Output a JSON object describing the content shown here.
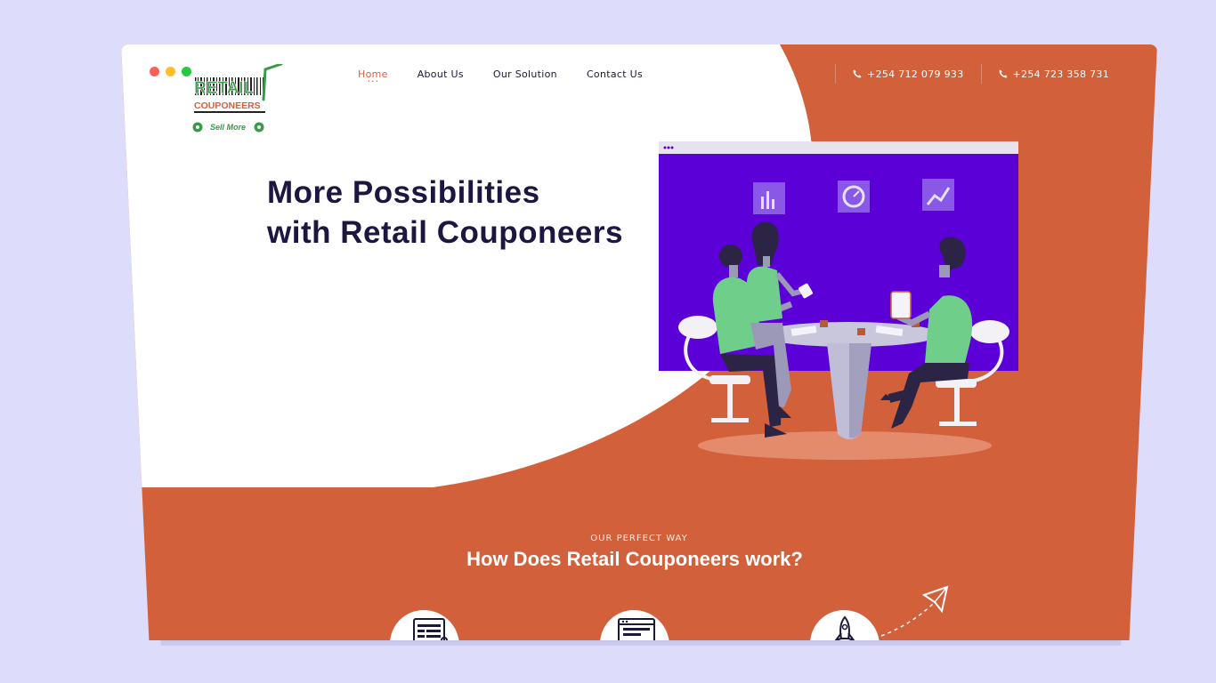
{
  "window": {
    "traffic_lights": [
      "#fe5f57",
      "#febc2e",
      "#28c840"
    ]
  },
  "logo": {
    "icon": "retail-couponeers-logo",
    "line1": "RETAIL",
    "line2": "COUPONEERS",
    "tagline": "Sell More"
  },
  "nav": {
    "items": [
      {
        "label": "Home",
        "active": true
      },
      {
        "label": "About Us",
        "active": false
      },
      {
        "label": "Our Solution",
        "active": false
      },
      {
        "label": "Contact Us",
        "active": false
      }
    ]
  },
  "contact": {
    "phone_icon": "phone-icon",
    "phone1": "+254 712 079 933",
    "phone2": "+254 723 358 731"
  },
  "hero": {
    "headline_line1": "More Possibilities",
    "headline_line2": "with Retail Couponeers",
    "illustration": "team-meeting-illustration"
  },
  "how_it_works": {
    "eyebrow": "OUR PERFECT WAY",
    "title": "How Does Retail Couponeers work?",
    "steps": [
      {
        "icon": "document-list-icon"
      },
      {
        "icon": "browser-window-icon"
      },
      {
        "icon": "rocket-icon"
      }
    ],
    "decoration": "paper-plane-icon"
  },
  "colors": {
    "background": "#dddcfa",
    "accent": "#d2603b",
    "hero_white": "#ffffff",
    "headline": "#1c1640",
    "illustration_purple": "#5c00d8",
    "figure_green": "#6fcf8a"
  }
}
